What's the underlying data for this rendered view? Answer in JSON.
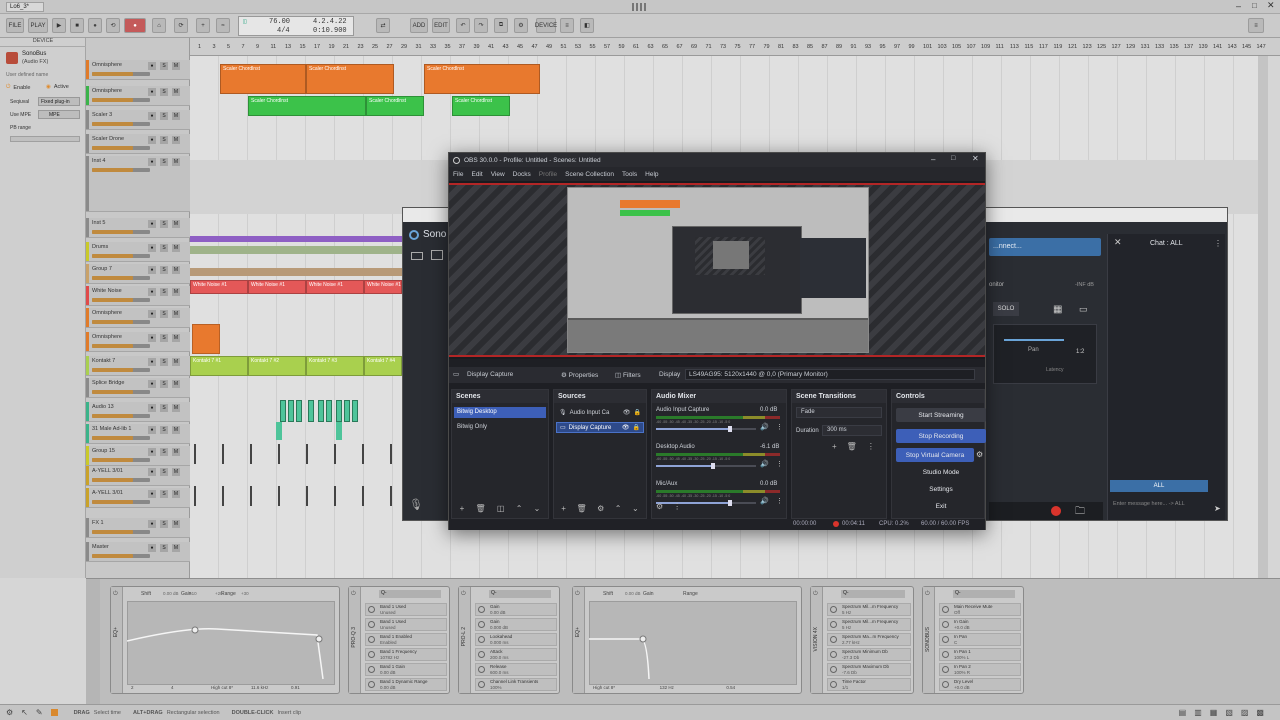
{
  "bitwig": {
    "tab_title": "Lo6_3*",
    "toolbar": {
      "file": "FILE",
      "play": "PLAY",
      "tempo": "76.00",
      "signature": "4/4",
      "position": "4.2.4.22",
      "time": "0:10.900",
      "add": "ADD",
      "edit": "EDIT",
      "device": "DEVICE"
    },
    "device_panel": {
      "header": "DEVICE",
      "plugin_name": "SonoBus",
      "plugin_sub": "(Audio FX)",
      "user_defined": "User defined name",
      "enable": "Enable",
      "active": "Active",
      "sequence_label": "Seqiuval",
      "sequence_value": "Fixed plug-in",
      "use_mpe_label": "Use MPE",
      "use_mpe_value": "MPE",
      "pb_range": "PB range"
    },
    "tracks": [
      {
        "name": "Omnisphere",
        "color": "#e07b2a"
      },
      {
        "name": "Omnisphere",
        "color": "#3bb34a"
      },
      {
        "name": "Scaler 3",
        "color": "#8a8a8a"
      },
      {
        "name": "Scaler Drone",
        "color": "#8a8a8a"
      },
      {
        "name": "Inst 4",
        "color": "#8a8a8a"
      },
      {
        "name": "Inst 5",
        "color": "#8a8a8a"
      },
      {
        "name": "Drums",
        "color": "#c9c92a"
      },
      {
        "name": "Group 7",
        "color": "#c9a26a"
      },
      {
        "name": "White Noise",
        "color": "#e04a4a"
      },
      {
        "name": "Omnisphere",
        "color": "#e07b2a"
      },
      {
        "name": "Omnisphere",
        "color": "#e07b2a"
      },
      {
        "name": "Kontakt 7",
        "color": "#a9cf50"
      },
      {
        "name": "Splice Bridge",
        "color": "#8a8a8a"
      },
      {
        "name": "Audio 13",
        "color": "#3bb38a"
      },
      {
        "name": "31 Male Ad-lib 1",
        "color": "#3bb38a"
      },
      {
        "name": "Group 15",
        "color": "#c9c92a"
      },
      {
        "name": "A-YELL 3/01",
        "color": "#c9a22a"
      },
      {
        "name": "A-YELL 3/01",
        "color": "#c9a22a"
      },
      {
        "name": "FX 1",
        "color": "#8a8a8a"
      },
      {
        "name": "Master",
        "color": "#8a8a8a"
      }
    ],
    "ruler_marks": [
      "1",
      "3",
      "5",
      "7",
      "9",
      "11",
      "13",
      "15",
      "17",
      "19",
      "21",
      "23",
      "25",
      "27",
      "29",
      "31",
      "33",
      "35",
      "37",
      "39",
      "41",
      "43",
      "45",
      "47",
      "49",
      "51",
      "53",
      "55",
      "57",
      "59",
      "61",
      "63",
      "65",
      "67",
      "69",
      "71",
      "73",
      "75",
      "77",
      "79",
      "81",
      "83",
      "85",
      "87",
      "89",
      "91",
      "93",
      "95",
      "97",
      "99",
      "101",
      "103",
      "105",
      "107",
      "109",
      "111",
      "113",
      "115",
      "117",
      "119",
      "121",
      "123",
      "125",
      "127",
      "129",
      "131",
      "133",
      "135",
      "137",
      "139",
      "141",
      "143",
      "145",
      "147"
    ],
    "clips": {
      "scaler_chords": "Scaler Chordlnst",
      "white_noise": "White Noise #1",
      "kontakt": [
        "Kontakt 7 #1",
        "Kontakt 7 #2",
        "Kontakt 7 #3",
        "Kontakt 7 #4"
      ]
    },
    "devices": [
      {
        "title": "EQ+",
        "labels": [
          "Shift",
          "Gain",
          "Range"
        ],
        "values": [
          "0.00 dB",
          "+10",
          "+20",
          "+30"
        ],
        "footer": [
          "2",
          "4",
          "High cut 8*",
          "11.6 kHz",
          "0.91"
        ]
      },
      {
        "title": "PRO-Q 3",
        "params": [
          "Band 1 Used",
          "Band 1 Used",
          "Band 1 Enabled",
          "Band 1 Frequency",
          "Band 1 Gain",
          "Band 1 Dynamic Range"
        ],
        "values": [
          "Unused",
          "Unused",
          "Enabled",
          "10782 Hz",
          "0.00 dB",
          "0.00 dB"
        ]
      },
      {
        "title": "PRO-L 2",
        "params": [
          "Gain",
          "Gain",
          "Lookahead",
          "Attack",
          "Release",
          "Channel Link Transients"
        ],
        "values": [
          "0.00 dB",
          "0.000 dB",
          "0.000 ms",
          "200.0 ms",
          "600.0 ms",
          "100%"
        ]
      },
      {
        "title": "EQ+",
        "labels": [
          "Shift",
          "Gain",
          "Range"
        ],
        "values": [
          "0.00 dB"
        ],
        "footer": [
          "High cut 8*",
          "132 Hz",
          "0.54"
        ]
      },
      {
        "title": "VISION 4X",
        "params": [
          "Spectrum Mil...m Frequency",
          "Spectrum Mil...m Frequency",
          "Spectrum Ma...m Frequency",
          "Spectrum Minimum Db",
          "Spectrum Maximum Db",
          "Time Factor"
        ],
        "values": [
          "5 Hz",
          "5 Hz",
          "2.77 kHz",
          "-27.3 Db",
          "-7.6 Db",
          "1/1"
        ]
      },
      {
        "title": "SONOBUS",
        "params": [
          "Main Receive Mute",
          "In Gain",
          "In Pan",
          "In Pan 1",
          "In Pan 2",
          "Dry Level"
        ],
        "values": [
          "Off",
          "+0.0 dB",
          "C",
          "100% L",
          "100% R",
          "+0.0 dB"
        ]
      }
    ],
    "status": {
      "drag": "DRAG",
      "drag_desc": "Select time",
      "alt_drag": "ALT+DRAG",
      "alt_drag_desc": "Rectangular selection",
      "dbl_click": "DOUBLE-CLICK",
      "dbl_click_desc": "Insert clip"
    }
  },
  "sonobus": {
    "title": "Sono",
    "connect": "...nnect...",
    "monitor": "onitor",
    "solo": "SOLO",
    "pan": "Pan",
    "latency": "Latency",
    "chat_title": "Chat : ALL",
    "all_button": "ALL",
    "chat_placeholder": "Enter message here... -> ALL",
    "chat_db": "-INF dB",
    "ratio": "1:2"
  },
  "obs": {
    "title": "OBS 30.0.0 - Profile: Untitled - Scenes: Untitled",
    "menu": [
      "File",
      "Edit",
      "View",
      "Docks",
      "Profile",
      "Scene Collection",
      "Tools",
      "Help"
    ],
    "source_name": "Display Capture",
    "properties": "Properties",
    "filters": "Filters",
    "display_label": "Display",
    "display_value": "LS49AG95: 5120x1440 @ 0,0 (Primary Monitor)",
    "scenes_title": "Scenes",
    "scenes": [
      "Bitwig Desktop",
      "Bitwig Only"
    ],
    "sources_title": "Sources",
    "sources": [
      "Audio Input Ca",
      "Display Capture"
    ],
    "mixer_title": "Audio Mixer",
    "mixer": [
      {
        "name": "Audio Input Capture",
        "db": "0.0 dB",
        "level": 0.72
      },
      {
        "name": "Desktop Audio",
        "db": "-6.1 dB",
        "level": 0.55
      },
      {
        "name": "Mic/Aux",
        "db": "0.0 dB",
        "level": 0.72
      }
    ],
    "meter_ticks": "-60 -55 -50 -45 -40 -35 -30 -25 -20 -15 -10 -5 0",
    "transitions_title": "Scene Transitions",
    "transition": "Fade",
    "duration_label": "Duration",
    "duration_value": "300 ms",
    "controls_title": "Controls",
    "controls": [
      "Start Streaming",
      "Stop Recording",
      "Stop Virtual Camera",
      "Studio Mode",
      "Settings",
      "Exit"
    ],
    "status": {
      "stream_time": "00:00:00",
      "rec_time": "00:04:11",
      "cpu": "CPU: 0.2%",
      "fps": "60.00 / 60.00 FPS"
    }
  },
  "colors": {
    "accent_blue": "#3d5fb8",
    "orange_clip": "#e8792e",
    "green_clip": "#3cc24a",
    "red_rec": "#d9342c"
  }
}
